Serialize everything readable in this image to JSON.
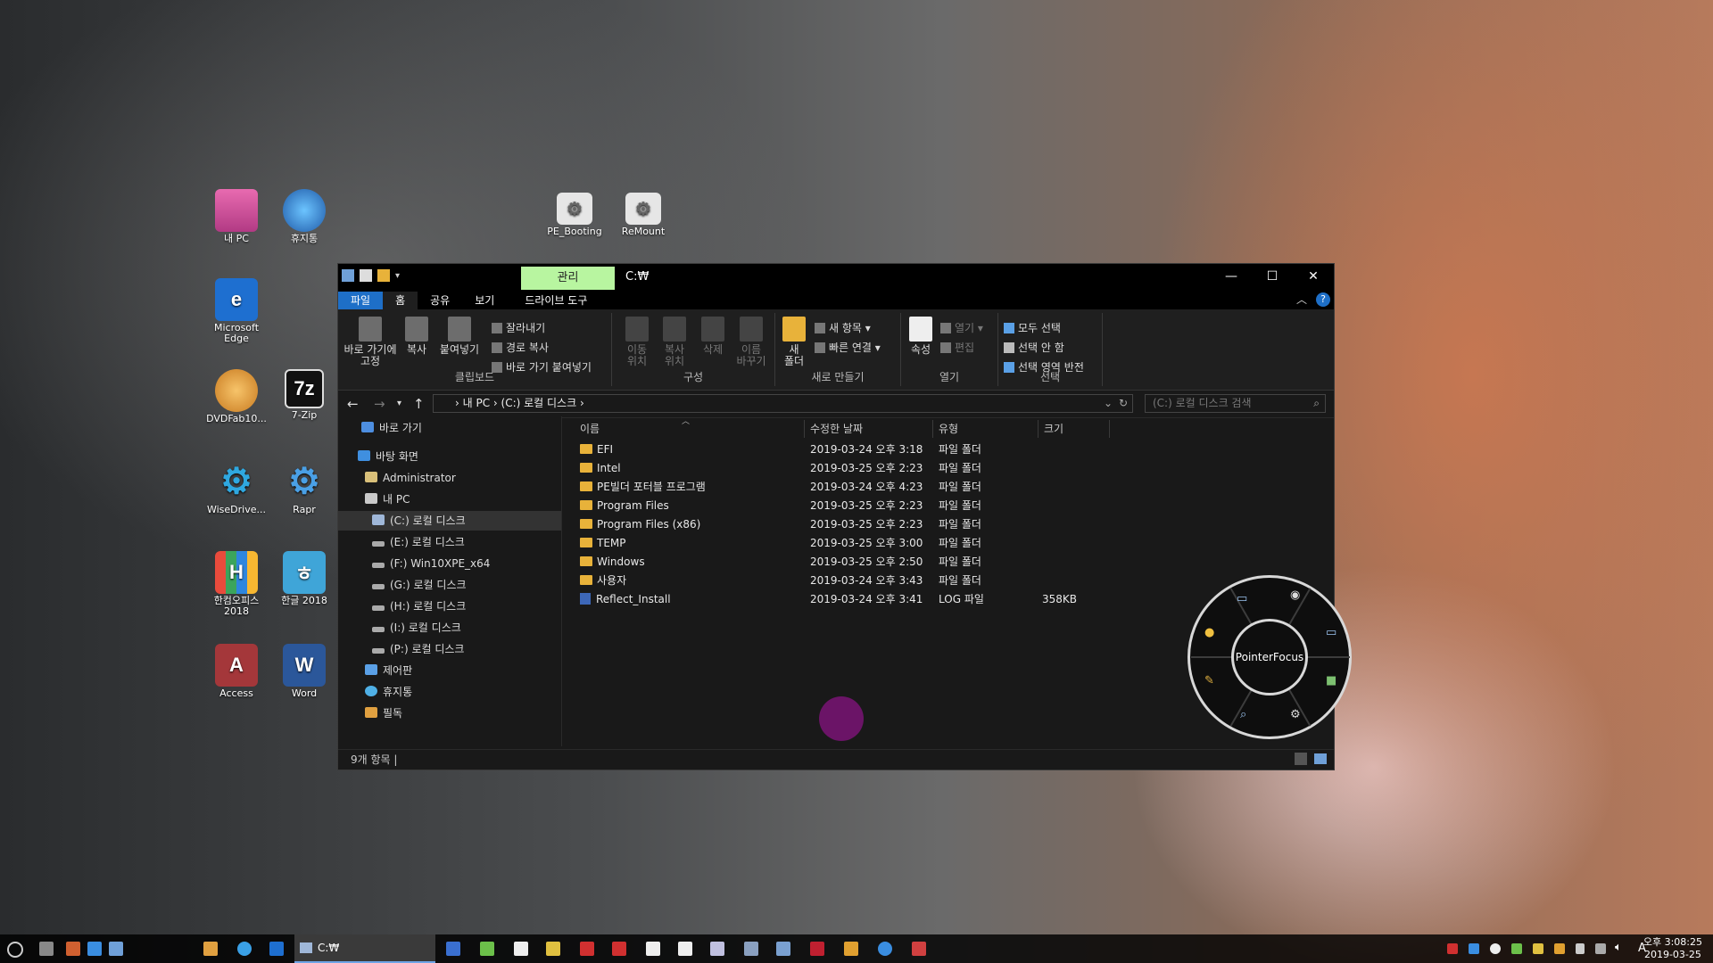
{
  "desktop": {
    "icons": [
      {
        "label": "내 PC",
        "icon": "computer-icon"
      },
      {
        "label": "휴지통",
        "icon": "recycle-bin-icon"
      },
      {
        "label": "Microsoft Edge",
        "icon": "edge-icon"
      },
      {
        "label": "DVDFab10...",
        "icon": "dvdfab-icon"
      },
      {
        "label": "7-Zip",
        "icon": "7zip-icon"
      },
      {
        "label": "WiseDrive...",
        "icon": "gear-icon"
      },
      {
        "label": "Rapr",
        "icon": "wrench-gear-icon"
      },
      {
        "label": "한컴오피스 2018",
        "icon": "hancom-office-icon"
      },
      {
        "label": "한글 2018",
        "icon": "hwp-icon"
      },
      {
        "label": "Access",
        "icon": "access-icon"
      },
      {
        "label": "Word",
        "icon": "word-icon"
      },
      {
        "label": "PE_Booting",
        "icon": "settings-file-icon"
      },
      {
        "label": "ReMount",
        "icon": "settings-file-icon"
      }
    ]
  },
  "explorer": {
    "manage_tab": "관리",
    "title": "C:₩",
    "window_controls": {
      "minimize": "—",
      "maximize": "☐",
      "close": "✕"
    },
    "tabs": [
      "파일",
      "홈",
      "공유",
      "보기",
      "드라이브 도구"
    ],
    "help": "?",
    "ribbon": {
      "clipboard": {
        "pin": "바로 가기에\n고정",
        "copy": "복사",
        "paste": "붙여넣기",
        "cut": "잘라내기",
        "copy_path": "경로 복사",
        "paste_shortcut": "바로 가기 붙여넣기",
        "label": "클립보드"
      },
      "organize": {
        "move_to": "이동\n위치",
        "copy_to": "복사\n위치",
        "delete": "삭제",
        "rename": "이름\n바꾸기",
        "label": "구성"
      },
      "new": {
        "new_folder": "새\n폴더",
        "new_item": "새 항목 ▾",
        "easy_access": "빠른 연결 ▾",
        "label": "새로 만들기"
      },
      "open": {
        "properties": "속성",
        "open": "열기 ▾",
        "edit": "편집",
        "label": "열기"
      },
      "select": {
        "select_all": "모두 선택",
        "select_none": "선택 안 함",
        "invert": "선택 영역 반전",
        "label": "선택"
      }
    },
    "address": {
      "path": "› 내 PC  ›  (C:) 로컬 디스크  ›",
      "search_placeholder": "(C:) 로컬 디스크 검색"
    },
    "nav": [
      {
        "label": "바로 가기",
        "icon": "star-icon"
      },
      {
        "label": "바탕 화면",
        "icon": "desktop-icon"
      },
      {
        "label": "Administrator",
        "icon": "user-icon"
      },
      {
        "label": "내 PC",
        "icon": "computer-icon"
      },
      {
        "label": "(C:) 로컬 디스크",
        "icon": "drive-icon"
      },
      {
        "label": "(E:) 로컬 디스크",
        "icon": "drive-icon"
      },
      {
        "label": "(F:) Win10XPE_x64",
        "icon": "drive-icon"
      },
      {
        "label": "(G:) 로컬 디스크",
        "icon": "drive-icon"
      },
      {
        "label": "(H:) 로컬 디스크",
        "icon": "drive-icon"
      },
      {
        "label": "(I:) 로컬 디스크",
        "icon": "drive-icon"
      },
      {
        "label": "(P:) 로컬 디스크",
        "icon": "drive-icon"
      },
      {
        "label": "제어판",
        "icon": "control-panel-icon"
      },
      {
        "label": "휴지통",
        "icon": "recycle-bin-icon"
      },
      {
        "label": "필독",
        "icon": "shortcut-icon"
      }
    ],
    "columns": [
      "이름",
      "수정한 날짜",
      "유형",
      "크기"
    ],
    "files": [
      {
        "name": "EFI",
        "date": "2019-03-24 오후 3:18",
        "type": "파일 폴더",
        "size": ""
      },
      {
        "name": "Intel",
        "date": "2019-03-25 오후 2:23",
        "type": "파일 폴더",
        "size": ""
      },
      {
        "name": "PE빌더 포터블 프로그램",
        "date": "2019-03-24 오후 4:23",
        "type": "파일 폴더",
        "size": ""
      },
      {
        "name": "Program Files",
        "date": "2019-03-25 오후 2:23",
        "type": "파일 폴더",
        "size": ""
      },
      {
        "name": "Program Files (x86)",
        "date": "2019-03-25 오후 2:23",
        "type": "파일 폴더",
        "size": ""
      },
      {
        "name": "TEMP",
        "date": "2019-03-25 오후 3:00",
        "type": "파일 폴더",
        "size": ""
      },
      {
        "name": "Windows",
        "date": "2019-03-25 오후 2:50",
        "type": "파일 폴더",
        "size": ""
      },
      {
        "name": "사용자",
        "date": "2019-03-24 오후 3:43",
        "type": "파일 폴더",
        "size": ""
      },
      {
        "name": "Reflect_Install",
        "date": "2019-03-24 오후 3:41",
        "type": "LOG 파일",
        "size": "358KB"
      }
    ],
    "status": "9개 항목  |"
  },
  "pointer_focus": {
    "label": "PointerFocus"
  },
  "taskbar": {
    "active_window": "C:₩",
    "clock_time": "오후 3:08:25",
    "clock_date": "2019-03-25",
    "ime": "A"
  },
  "colors": {
    "accent": "#1e6fc7",
    "manage_tab": "#b8f5a0",
    "folder": "#e8b23a",
    "pointer_dot": "#6b1467"
  }
}
